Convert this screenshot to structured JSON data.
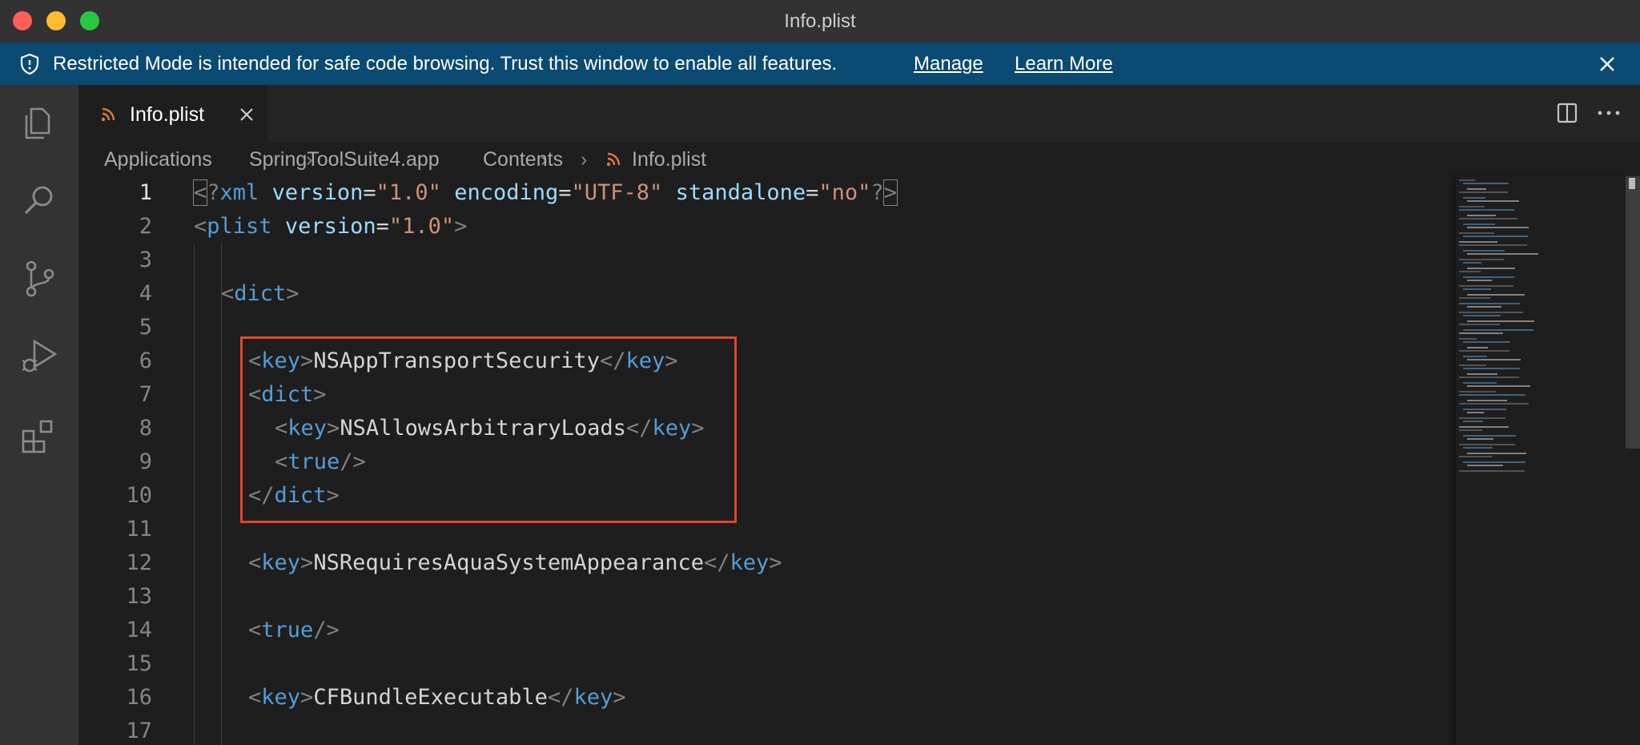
{
  "window": {
    "title": "Info.plist"
  },
  "banner": {
    "message": "Restricted Mode is intended for safe code browsing. Trust this window to enable all features.",
    "manage_label": "Manage",
    "learn_more_label": "Learn More"
  },
  "tab": {
    "label": "Info.plist"
  },
  "breadcrumb": {
    "items": [
      "Applications",
      "SpringToolSuite4.app",
      "Contents",
      "Info.plist"
    ]
  },
  "editor": {
    "line_numbers": [
      "1",
      "2",
      "3",
      "4",
      "5",
      "6",
      "7",
      "8",
      "9",
      "10",
      "11",
      "12",
      "13",
      "14",
      "15",
      "16",
      "17"
    ],
    "current_line": "1",
    "lines": {
      "l1": {
        "xml": "xml",
        "version_attr": "version",
        "version_val": "\"1.0\"",
        "encoding_attr": "encoding",
        "encoding_val": "\"UTF-8\"",
        "standalone_attr": "standalone",
        "standalone_val": "\"no\""
      },
      "l2": {
        "tag": "plist",
        "attr": "version",
        "val": "\"1.0\""
      },
      "l4": {
        "tag": "dict"
      },
      "l6": {
        "tag": "key",
        "text": "NSAppTransportSecurity"
      },
      "l7": {
        "tag": "dict"
      },
      "l8": {
        "tag": "key",
        "text": "NSAllowsArbitraryLoads"
      },
      "l9": {
        "tag": "true"
      },
      "l10": {
        "tag": "dict"
      },
      "l12": {
        "tag": "key",
        "text": "NSRequiresAquaSystemAppearance"
      },
      "l14": {
        "tag": "true"
      },
      "l16": {
        "tag": "key",
        "text": "CFBundleExecutable"
      }
    }
  },
  "colors": {
    "banner_bg": "#0b4a73",
    "highlight_box": "#e8432f",
    "tag": "#569cd6",
    "string": "#ce9178",
    "attribute": "#9cdcfe",
    "rss_icon": "#e37933"
  },
  "icons": [
    "shield-icon",
    "close-icon",
    "explorer-icon",
    "search-icon",
    "source-control-icon",
    "run-debug-icon",
    "extensions-icon",
    "rss-icon",
    "split-editor-icon",
    "more-actions-icon",
    "chevron-right-icon"
  ]
}
